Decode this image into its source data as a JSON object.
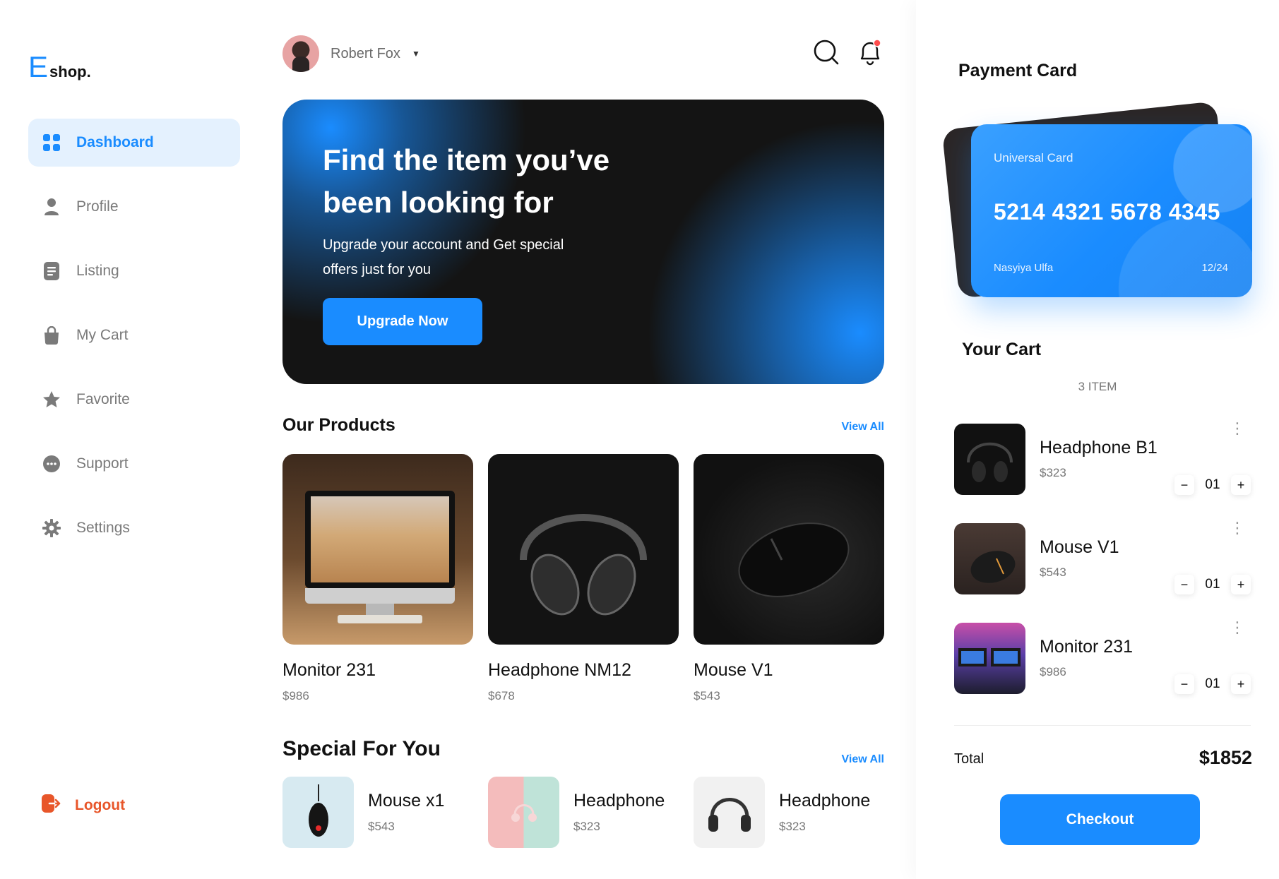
{
  "logo": {
    "letter": "E",
    "text": "shop."
  },
  "sidebar": {
    "items": [
      {
        "label": "Dashboard",
        "icon": "grid-icon",
        "active": true
      },
      {
        "label": "Profile",
        "icon": "user-icon",
        "active": false
      },
      {
        "label": "Listing",
        "icon": "document-icon",
        "active": false
      },
      {
        "label": "My Cart",
        "icon": "shopping-bag-icon",
        "active": false
      },
      {
        "label": "Favorite",
        "icon": "star-icon",
        "active": false
      },
      {
        "label": "Support",
        "icon": "chat-icon",
        "active": false
      },
      {
        "label": "Settings",
        "icon": "gear-icon",
        "active": false
      }
    ],
    "logout_label": "Logout"
  },
  "header": {
    "user_name": "Robert Fox"
  },
  "hero": {
    "title": "Find the item you’ve been looking for",
    "subtitle": "Upgrade your account and Get special offers just for you",
    "cta_label": "Upgrade Now"
  },
  "products": {
    "title": "Our Products",
    "view_all": "View All",
    "items": [
      {
        "name": "Monitor 231",
        "price": "$986"
      },
      {
        "name": "Headphone NM12",
        "price": "$678"
      },
      {
        "name": "Mouse V1",
        "price": "$543"
      }
    ]
  },
  "specials": {
    "title": "Special For You",
    "view_all": "View All",
    "items": [
      {
        "name": "Mouse x1",
        "price": "$543"
      },
      {
        "name": "Headphone",
        "price": "$323"
      },
      {
        "name": "Headphone",
        "price": "$323"
      }
    ]
  },
  "payment": {
    "title": "Payment Card",
    "card_brand": "Universal Card",
    "card_number": "5214 4321 5678 4345",
    "card_holder": "Nasyiya Ulfa",
    "card_expiry": "12/24"
  },
  "cart": {
    "title": "Your Cart",
    "count_label": "3 ITEM",
    "items": [
      {
        "name": "Headphone B1",
        "price": "$323",
        "qty": "01"
      },
      {
        "name": "Mouse V1",
        "price": "$543",
        "qty": "01"
      },
      {
        "name": "Monitor 231",
        "price": "$986",
        "qty": "01"
      }
    ],
    "total_label": "Total",
    "total_value": "$1852",
    "checkout_label": "Checkout"
  },
  "colors": {
    "accent": "#1a8cff",
    "danger": "#e8562a",
    "hero_bg": "#141414"
  }
}
